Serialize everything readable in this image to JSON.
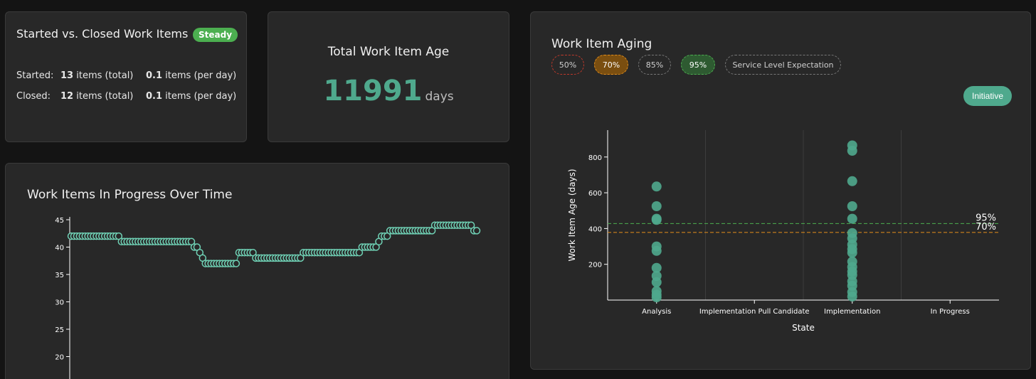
{
  "started_closed": {
    "title": "Started vs. Closed Work Items",
    "badge": "Steady",
    "started": {
      "label": "Started:",
      "total_count": "13",
      "total_unit": "items (total)",
      "per_day": "0.1",
      "per_day_unit": "items (per day)"
    },
    "closed": {
      "label": "Closed:",
      "total_count": "12",
      "total_unit": "items (total)",
      "per_day": "0.1",
      "per_day_unit": "items (per day)"
    }
  },
  "total_age": {
    "title": "Total Work Item Age",
    "value": "11991",
    "unit": "days"
  },
  "wip_chart": {
    "title": "Work Items In Progress Over Time"
  },
  "aging": {
    "title": "Work Item Aging",
    "legend": [
      "50%",
      "70%",
      "85%",
      "95%",
      "Service Level Expectation"
    ],
    "initiative_button": "Initiative"
  },
  "colors": {
    "accent": "#4fa98d",
    "steady": "#4caf50",
    "p70": "#e58e1a",
    "p95": "#4caf50"
  },
  "chart_data": [
    {
      "type": "line",
      "title": "Work Items In Progress Over Time",
      "xlabel": "",
      "ylabel": "",
      "yticks": [
        20,
        25,
        30,
        35,
        40,
        45
      ],
      "ylim": [
        16,
        45
      ],
      "grid": false,
      "series": [
        {
          "values": [
            42,
            42,
            42,
            42,
            42,
            42,
            42,
            42,
            42,
            42,
            42,
            42,
            42,
            42,
            42,
            42,
            42,
            42,
            41,
            41,
            41,
            41,
            41,
            41,
            41,
            41,
            41,
            41,
            41,
            41,
            41,
            41,
            41,
            41,
            41,
            41,
            41,
            41,
            41,
            41,
            41,
            41,
            41,
            41,
            40,
            40,
            39,
            38,
            37,
            37,
            37,
            37,
            37,
            37,
            37,
            37,
            37,
            37,
            37,
            37,
            39,
            39,
            39,
            39,
            39,
            39,
            38,
            38,
            38,
            38,
            38,
            38,
            38,
            38,
            38,
            38,
            38,
            38,
            38,
            38,
            38,
            38,
            38,
            39,
            39,
            39,
            39,
            39,
            39,
            39,
            39,
            39,
            39,
            39,
            39,
            39,
            39,
            39,
            39,
            39,
            39,
            39,
            39,
            39,
            40,
            40,
            40,
            40,
            40,
            40,
            41,
            42,
            42,
            42,
            43,
            43,
            43,
            43,
            43,
            43,
            43,
            43,
            43,
            43,
            43,
            43,
            43,
            43,
            43,
            43,
            44,
            44,
            44,
            44,
            44,
            44,
            44,
            44,
            44,
            44,
            44,
            44,
            44,
            44,
            43,
            43
          ]
        }
      ]
    },
    {
      "type": "scatter",
      "title": "Work Item Aging",
      "xlabel": "State",
      "ylabel": "Work Item Age (days)",
      "categories": [
        "Analysis",
        "Implementation Pull Candidate",
        "Implementation",
        "In Progress"
      ],
      "yticks": [
        200,
        400,
        600,
        800
      ],
      "ylim": [
        0,
        940
      ],
      "grid": false,
      "percentile_lines": [
        {
          "label": "95%",
          "value": 428
        },
        {
          "label": "70%",
          "value": 378
        }
      ],
      "points": [
        {
          "x": "Analysis",
          "y": 635
        },
        {
          "x": "Analysis",
          "y": 525
        },
        {
          "x": "Analysis",
          "y": 455
        },
        {
          "x": "Analysis",
          "y": 448
        },
        {
          "x": "Analysis",
          "y": 300
        },
        {
          "x": "Analysis",
          "y": 275
        },
        {
          "x": "Analysis",
          "y": 180
        },
        {
          "x": "Analysis",
          "y": 135
        },
        {
          "x": "Analysis",
          "y": 100
        },
        {
          "x": "Analysis",
          "y": 50
        },
        {
          "x": "Analysis",
          "y": 30
        },
        {
          "x": "Analysis",
          "y": 15
        },
        {
          "x": "Implementation",
          "y": 865
        },
        {
          "x": "Implementation",
          "y": 835
        },
        {
          "x": "Implementation",
          "y": 665
        },
        {
          "x": "Implementation",
          "y": 525
        },
        {
          "x": "Implementation",
          "y": 455
        },
        {
          "x": "Implementation",
          "y": 375
        },
        {
          "x": "Implementation",
          "y": 345
        },
        {
          "x": "Implementation",
          "y": 310
        },
        {
          "x": "Implementation",
          "y": 285
        },
        {
          "x": "Implementation",
          "y": 265
        },
        {
          "x": "Implementation",
          "y": 215
        },
        {
          "x": "Implementation",
          "y": 185
        },
        {
          "x": "Implementation",
          "y": 160
        },
        {
          "x": "Implementation",
          "y": 140
        },
        {
          "x": "Implementation",
          "y": 105
        },
        {
          "x": "Implementation",
          "y": 80
        },
        {
          "x": "Implementation",
          "y": 45
        },
        {
          "x": "Implementation",
          "y": 20
        }
      ]
    }
  ]
}
